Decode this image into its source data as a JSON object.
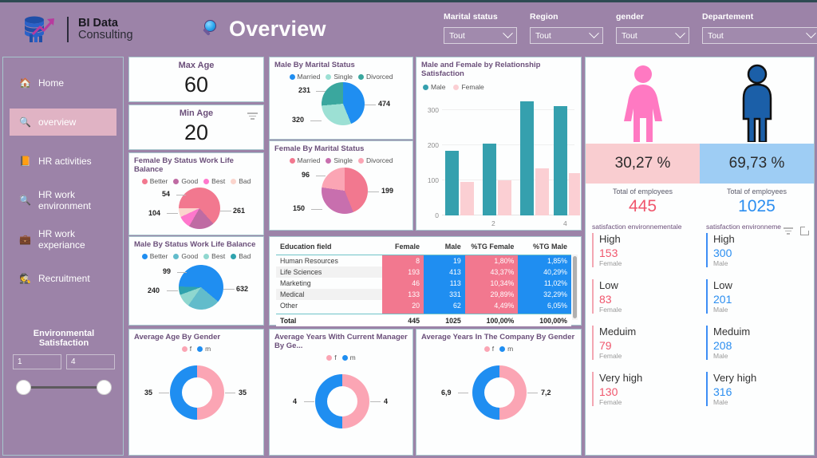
{
  "header": {
    "brand_line1": "BI Data",
    "brand_line2": "Consulting",
    "page_title": "Overview",
    "filters": [
      {
        "label": "Marital status",
        "value": "Tout"
      },
      {
        "label": "Region",
        "value": "Tout"
      },
      {
        "label": "gender",
        "value": "Tout"
      },
      {
        "label": "Departement",
        "value": "Tout"
      }
    ]
  },
  "sidebar": {
    "items": [
      {
        "label": "Home",
        "icon": "house-icon",
        "glyph": "🏠",
        "active": false
      },
      {
        "label": "overview",
        "icon": "magnifier-icon",
        "glyph": "🔍",
        "active": true
      },
      {
        "label": "HR activities",
        "icon": "books-icon",
        "glyph": "📙",
        "active": false
      },
      {
        "label": "HR work environment",
        "icon": "magnifier-icon",
        "glyph": "🔍",
        "active": false
      },
      {
        "label": "HR work experiance",
        "icon": "briefcase-icon",
        "glyph": "💼",
        "active": false
      },
      {
        "label": "Recruitment",
        "icon": "detective-icon",
        "glyph": "🕵️",
        "active": false
      }
    ],
    "slider": {
      "title": "Environmental Satisfaction",
      "min": "1",
      "max": "4"
    }
  },
  "cards": {
    "max_age": {
      "title": "Max Age",
      "value": "60"
    },
    "min_age": {
      "title": "Min Age",
      "value": "20"
    }
  },
  "chart_data": [
    {
      "id": "female_work_life_balance",
      "type": "pie",
      "title": "Female By Status Work Life Balance",
      "categories": [
        "Better",
        "Good",
        "Best",
        "Bad"
      ],
      "values": [
        261,
        104,
        54,
        31
      ],
      "labels_shown": [
        "261",
        "104",
        "54"
      ],
      "colors": [
        "#f2788f",
        "#bf6ba3",
        "#ff77cc",
        "#fbd5cd"
      ],
      "legend": "top"
    },
    {
      "id": "male_work_life_balance",
      "type": "pie",
      "title": "Male By Status Work Life Balance",
      "categories": [
        "Better",
        "Good",
        "Best",
        "Bad"
      ],
      "values": [
        632,
        240,
        99,
        54
      ],
      "labels_shown": [
        "632",
        "240",
        "99"
      ],
      "colors": [
        "#1f8ef1",
        "#62bccb",
        "#8fd7cf",
        "#2fa3ae"
      ],
      "legend": "top"
    },
    {
      "id": "male_marital_status",
      "type": "pie",
      "title": "Male By Marital Status",
      "categories": [
        "Married",
        "Single",
        "Divorced"
      ],
      "values": [
        474,
        320,
        231
      ],
      "labels_shown": [
        "474",
        "320",
        "231"
      ],
      "colors": [
        "#1f8ef1",
        "#9ce0d4",
        "#3aa79e"
      ],
      "legend": "top"
    },
    {
      "id": "female_marital_status",
      "type": "pie",
      "title": "Female By Marital Status",
      "categories": [
        "Married",
        "Single",
        "Divorced"
      ],
      "values": [
        199,
        150,
        96
      ],
      "labels_shown": [
        "199",
        "150",
        "96"
      ],
      "colors": [
        "#f2788f",
        "#c86fae",
        "#fba5b4"
      ],
      "legend": "top"
    },
    {
      "id": "relationship_satisfaction",
      "type": "bar",
      "title": "Male and Female by Relationship Satisfaction",
      "categories": [
        "1",
        "2",
        "3",
        "4"
      ],
      "xtick_labels": [
        "2",
        "4"
      ],
      "series": [
        {
          "name": "Male",
          "values": [
            185,
            205,
            325,
            312
          ],
          "color": "#35a0ae"
        },
        {
          "name": "Female",
          "values": [
            95,
            100,
            135,
            120
          ],
          "color": "#fbcfd3"
        }
      ],
      "ylim": [
        0,
        340
      ],
      "yticks": [
        0,
        100,
        200,
        300
      ],
      "xlabel": "",
      "ylabel": "",
      "grid": true,
      "legend": "top"
    },
    {
      "id": "education_field_table",
      "type": "table",
      "title": "Education field",
      "columns": [
        "Education field",
        "Female",
        "Male",
        "%TG Female",
        "%TG Male"
      ],
      "rows": [
        [
          "Human Resources",
          "8",
          "19",
          "1,80%",
          "1,85%"
        ],
        [
          "Life Sciences",
          "193",
          "413",
          "43,37%",
          "40,29%"
        ],
        [
          "Marketing",
          "46",
          "113",
          "10,34%",
          "11,02%"
        ],
        [
          "Medical",
          "133",
          "331",
          "29,89%",
          "32,29%"
        ],
        [
          "Other",
          "20",
          "62",
          "4,49%",
          "6,05%"
        ]
      ],
      "total_row": [
        "Total",
        "445",
        "1025",
        "100,00%",
        "100,00%"
      ]
    },
    {
      "id": "average_age_by_gender",
      "type": "pie",
      "title": "Average Age By Gender",
      "categories": [
        "f",
        "m"
      ],
      "values": [
        35,
        35
      ],
      "labels_shown": [
        "35",
        "35"
      ],
      "colors": [
        "#fba5b4",
        "#1f8ef1"
      ],
      "donut": true,
      "legend": "top"
    },
    {
      "id": "average_years_with_current_manager",
      "type": "pie",
      "title": "Average Years With Current Manager By Ge...",
      "categories": [
        "f",
        "m"
      ],
      "values": [
        4,
        4
      ],
      "labels_shown": [
        "4",
        "4"
      ],
      "colors": [
        "#fba5b4",
        "#1f8ef1"
      ],
      "donut": true,
      "legend": "top"
    },
    {
      "id": "average_years_in_company",
      "type": "pie",
      "title": "Average Years In The Company By Gender",
      "categories": [
        "f",
        "m"
      ],
      "values": [
        7.2,
        6.9
      ],
      "labels_shown": [
        "7,2",
        "6,9"
      ],
      "colors": [
        "#fba5b4",
        "#1f8ef1"
      ],
      "donut": true,
      "legend": "top"
    }
  ],
  "right_panel": {
    "female": {
      "percent": "30,27 %",
      "total_label": "Total of employees",
      "total": "445",
      "sat_header": "satisfaction environnementale",
      "items": [
        {
          "level": "High",
          "count": "153",
          "gender": "Female"
        },
        {
          "level": "Low",
          "count": "83",
          "gender": "Female"
        },
        {
          "level": "Meduim",
          "count": "79",
          "gender": "Female"
        },
        {
          "level": "Very high",
          "count": "130",
          "gender": "Female"
        }
      ]
    },
    "male": {
      "percent": "69,73 %",
      "total_label": "Total of employees",
      "total": "1025",
      "sat_header": "satisfaction environneme",
      "items": [
        {
          "level": "High",
          "count": "300",
          "gender": "Male"
        },
        {
          "level": "Low",
          "count": "201",
          "gender": "Male"
        },
        {
          "level": "Meduim",
          "count": "208",
          "gender": "Male"
        },
        {
          "level": "Very high",
          "count": "316",
          "gender": "Male"
        }
      ]
    }
  },
  "colors": {
    "background": "#9c83a8",
    "pink": "#f2788f",
    "blue": "#1f8ef1",
    "teal": "#35a0ae",
    "card_border": "#a7c6cd",
    "active_nav": "#e0b3c4"
  }
}
